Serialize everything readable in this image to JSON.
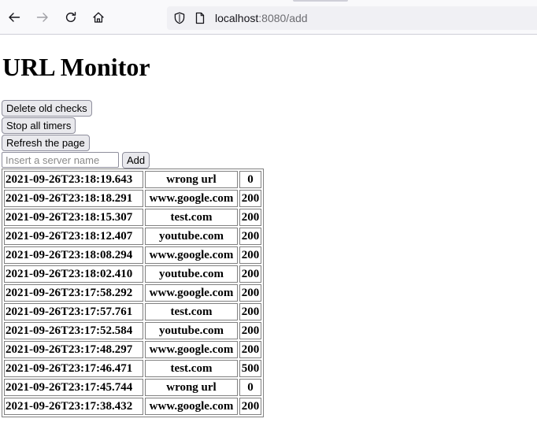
{
  "browser": {
    "url_host": "localhost",
    "url_rest": ":8080/add"
  },
  "page": {
    "title": "URL Monitor",
    "buttons": {
      "delete_old": "Delete old checks",
      "stop_timers": "Stop all timers",
      "refresh": "Refresh the page",
      "add": "Add"
    },
    "server_input": {
      "placeholder": "Insert a server name",
      "value": ""
    },
    "checks": [
      {
        "time": "2021-09-26T23:18:19.643",
        "url": "wrong url",
        "status": "0"
      },
      {
        "time": "2021-09-26T23:18:18.291",
        "url": "www.google.com",
        "status": "200"
      },
      {
        "time": "2021-09-26T23:18:15.307",
        "url": "test.com",
        "status": "200"
      },
      {
        "time": "2021-09-26T23:18:12.407",
        "url": "youtube.com",
        "status": "200"
      },
      {
        "time": "2021-09-26T23:18:08.294",
        "url": "www.google.com",
        "status": "200"
      },
      {
        "time": "2021-09-26T23:18:02.410",
        "url": "youtube.com",
        "status": "200"
      },
      {
        "time": "2021-09-26T23:17:58.292",
        "url": "www.google.com",
        "status": "200"
      },
      {
        "time": "2021-09-26T23:17:57.761",
        "url": "test.com",
        "status": "200"
      },
      {
        "time": "2021-09-26T23:17:52.584",
        "url": "youtube.com",
        "status": "200"
      },
      {
        "time": "2021-09-26T23:17:48.297",
        "url": "www.google.com",
        "status": "200"
      },
      {
        "time": "2021-09-26T23:17:46.471",
        "url": "test.com",
        "status": "500"
      },
      {
        "time": "2021-09-26T23:17:45.744",
        "url": "wrong url",
        "status": "0"
      },
      {
        "time": "2021-09-26T23:17:38.432",
        "url": "www.google.com",
        "status": "200"
      }
    ]
  },
  "icons": {
    "back": "arrow-left-icon",
    "forward": "arrow-right-icon",
    "reload": "reload-icon",
    "home": "home-icon",
    "tracking": "shield-icon",
    "page": "page-icon"
  },
  "colors": {
    "toolbar_bg": "#f9f9fb",
    "urlbar_bg": "#f0f0f4",
    "button_bg": "#e9e9ed",
    "border": "#808080"
  }
}
